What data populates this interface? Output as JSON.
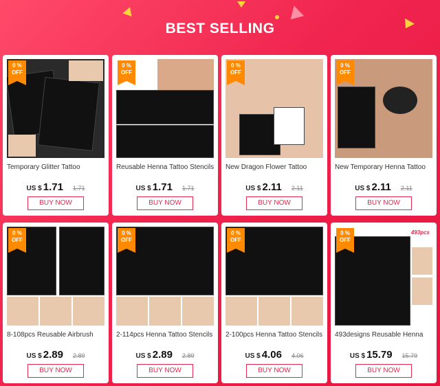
{
  "header": {
    "title": "BEST SELLING"
  },
  "badge": {
    "line1": "0 %",
    "line2": "OFF"
  },
  "currency": "US $",
  "button_label": "BUY NOW",
  "products": [
    {
      "name": "Temporary Glitter Tattoo",
      "price": "1.71",
      "old_price": "1.71",
      "badge": true
    },
    {
      "name": "Reusable Henna Tattoo Stencils",
      "price": "1.71",
      "old_price": "1.71",
      "badge": true
    },
    {
      "name": "New Dragon Flower Tattoo",
      "price": "2.11",
      "old_price": "2.11",
      "badge": true
    },
    {
      "name": "New Temporary Henna Tattoo",
      "price": "2.11",
      "old_price": "2.11",
      "badge": true
    },
    {
      "name": "8-108pcs Reusable Airbrush",
      "price": "2.89",
      "old_price": "2.89",
      "badge": true
    },
    {
      "name": "2-114pcs Henna Tattoo Stencils",
      "price": "2.89",
      "old_price": "2.89",
      "badge": true
    },
    {
      "name": "2-100pcs Henna Tattoo Stencils",
      "price": "4.06",
      "old_price": "4.06",
      "badge": true
    },
    {
      "name": "493designs Reusable Henna",
      "price": "15.79",
      "old_price": "15.79",
      "badge": true,
      "image_tag": "493pcs"
    }
  ]
}
